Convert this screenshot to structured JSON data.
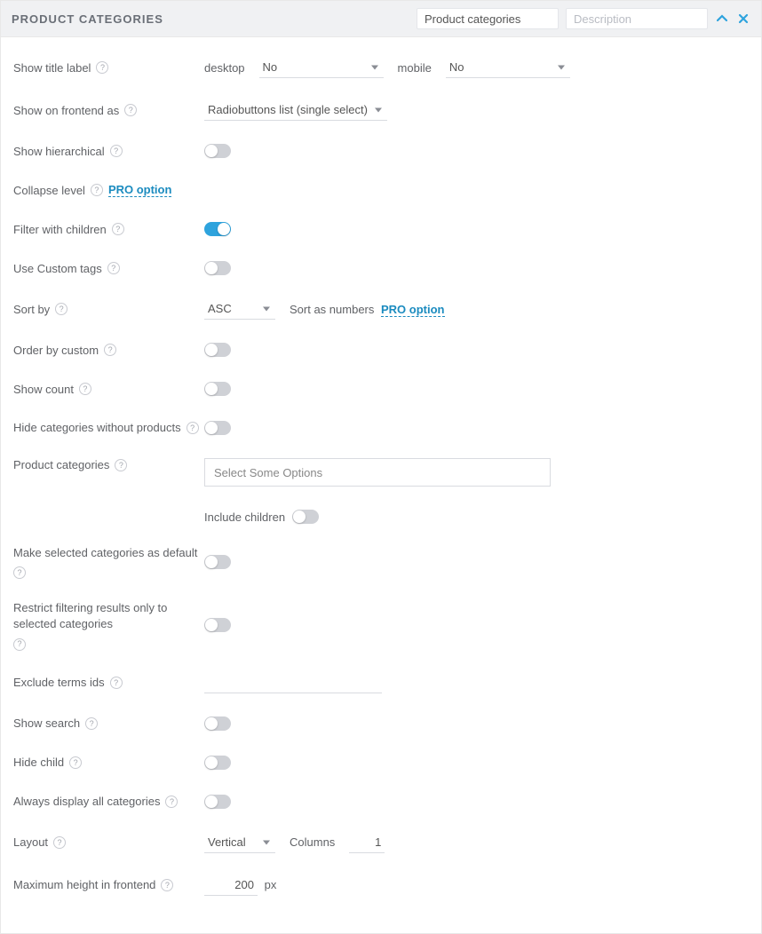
{
  "header": {
    "title": "PRODUCT CATEGORIES",
    "input1_value": "Product categories",
    "input2_placeholder": "Description"
  },
  "help_glyph": "?",
  "rows": {
    "show_title_label": {
      "label": "Show title label",
      "desktop_label": "desktop",
      "desktop_value": "No",
      "mobile_label": "mobile",
      "mobile_value": "No"
    },
    "show_on_frontend_as": {
      "label": "Show on frontend as",
      "value": "Radiobuttons list (single select)"
    },
    "show_hierarchical": {
      "label": "Show hierarchical",
      "value": false
    },
    "collapse_level": {
      "label": "Collapse level",
      "pro": "PRO option"
    },
    "filter_with_children": {
      "label": "Filter with children",
      "value": true
    },
    "use_custom_tags": {
      "label": "Use Custom tags",
      "value": false
    },
    "sort_by": {
      "label": "Sort by",
      "value": "ASC",
      "extra_label": "Sort as numbers",
      "pro": "PRO option"
    },
    "order_by_custom": {
      "label": "Order by custom",
      "value": false
    },
    "show_count": {
      "label": "Show count",
      "value": false
    },
    "hide_empty": {
      "label": "Hide categories without products",
      "value": false
    },
    "product_categories": {
      "label": "Product categories",
      "placeholder": "Select Some Options",
      "include_children_label": "Include children",
      "include_children_value": false
    },
    "make_default": {
      "label": "Make selected categories as default",
      "value": false
    },
    "restrict": {
      "label": "Restrict filtering results only to selected categories",
      "value": false
    },
    "exclude_terms": {
      "label": "Exclude terms ids",
      "value": ""
    },
    "show_search": {
      "label": "Show search",
      "value": false
    },
    "hide_child": {
      "label": "Hide child",
      "value": false
    },
    "always_display": {
      "label": "Always display all categories",
      "value": false
    },
    "layout": {
      "label": "Layout",
      "value": "Vertical",
      "columns_label": "Columns",
      "columns_value": "1"
    },
    "max_height": {
      "label": "Maximum height in frontend",
      "value": "200",
      "unit": "px"
    }
  }
}
